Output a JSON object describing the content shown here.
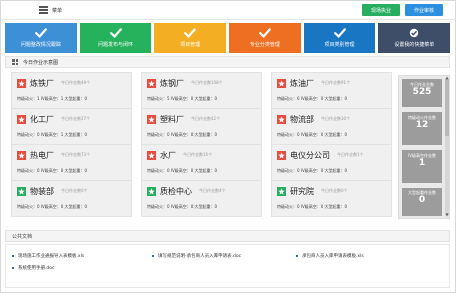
{
  "header": {
    "menu_label": "菜单",
    "btn_green": "现场执业",
    "btn_blue": "作业审核"
  },
  "tiles": [
    {
      "label": "问题整改情况跟踪",
      "color": "#3d8fd6"
    },
    {
      "label": "问题发布与闭环",
      "color": "#26b15d"
    },
    {
      "label": "项目管理",
      "color": "#f4ae23"
    },
    {
      "label": "专业分类管理",
      "color": "#ee6f22"
    },
    {
      "label": "项目类别管理",
      "color": "#1876c3"
    },
    {
      "label": "设置我的快捷菜单",
      "color": "#3e4d68"
    }
  ],
  "section": {
    "title": "今日作业示意图"
  },
  "cards": [
    {
      "name": "炼铁厂",
      "today": "今日作业数49个",
      "star": "red",
      "metrics": "特级动火：1 IV级高空：1 大型起重：0"
    },
    {
      "name": "炼钢厂",
      "today": "今日作业数108个",
      "star": "red",
      "metrics": "特级动火：5 IV级高空：0 大型起重：0"
    },
    {
      "name": "炼油厂",
      "today": "今日作业数91个",
      "star": "red",
      "metrics": "特级动火：6 IV级高空：0 大型起重：0"
    },
    {
      "name": "化工厂",
      "today": "今日作业数27个",
      "star": "red",
      "metrics": "特级动火：0 IV级高空：1 大型起重：0"
    },
    {
      "name": "塑料厂",
      "today": "今日作业数42个",
      "star": "red",
      "metrics": "特级动火：0 IV级高空：0 大型起重：0"
    },
    {
      "name": "物流部",
      "today": "今日作业数30个",
      "star": "red",
      "metrics": "特级动火：0 IV级高空：0 大型起重：0"
    },
    {
      "name": "热电厂",
      "today": "今日作业数73个",
      "star": "red",
      "metrics": "特级动火：0 IV级高空：0 大型起重：0"
    },
    {
      "name": "水厂",
      "today": "今日作业数16个",
      "star": "red",
      "metrics": "特级动火：0 IV级高空：0 大型起重：0"
    },
    {
      "name": "电仪分公司",
      "today": "今日作业数1个",
      "star": "red",
      "metrics": "特级动火：0 IV级高空：0 大型起重：0"
    },
    {
      "name": "物装部",
      "today": "今日作业数0个",
      "star": "green",
      "metrics": "特级动火：0 IV级高空：0 大型起重：0"
    },
    {
      "name": "质检中心",
      "today": "今日作业数4个",
      "star": "green",
      "metrics": "特级动火：0 IV级高空：0 大型起重：0"
    },
    {
      "name": "研究院",
      "today": "今日作业数0个",
      "star": "green",
      "metrics": "特级动火：0 IV级高空：0 大型起重：0"
    }
  ],
  "stats": [
    {
      "label": "今日作业总数",
      "value": "525"
    },
    {
      "label": "特级动火作业数",
      "value": "12"
    },
    {
      "label": "IV级高空作业数",
      "value": "1"
    },
    {
      "label": "大型起重作业数",
      "value": "0"
    }
  ],
  "docs": {
    "title": "公共文档",
    "items": [
      "现场施工作业通报导入表模板.xls",
      "填写规范说明-承包商人员入库申请表.doc",
      "承包商人员入库申请表模板.xls",
      "系统使用手册.doc"
    ]
  },
  "colors": {
    "star_red": "#e74c3c",
    "star_green": "#27ae60",
    "stat_bg": "#9c9c9c"
  }
}
